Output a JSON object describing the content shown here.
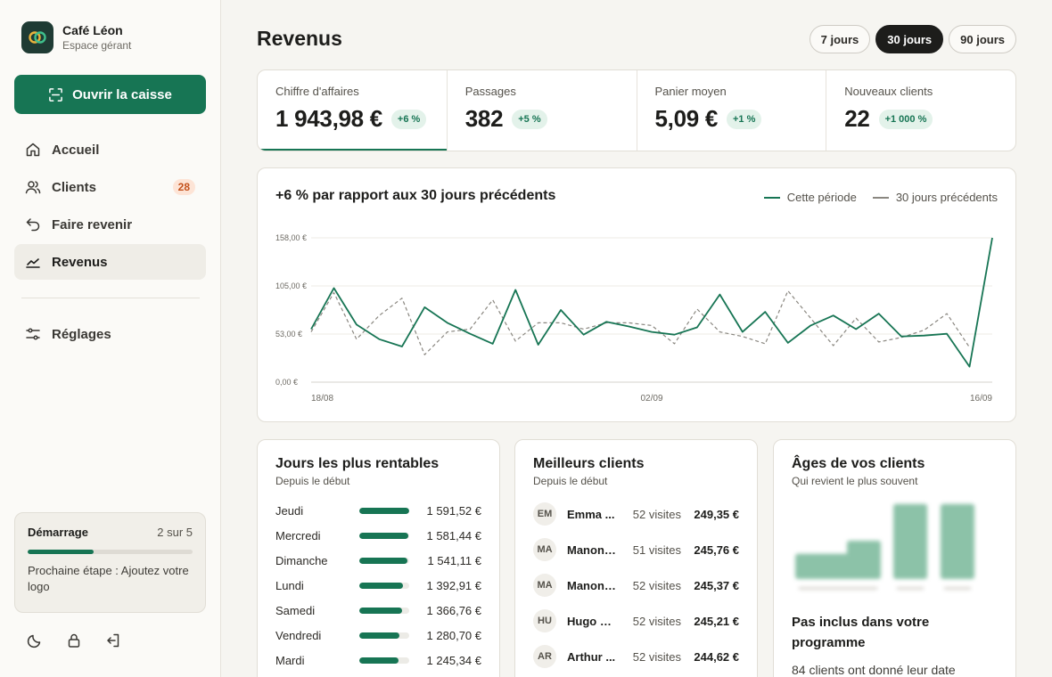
{
  "brand": {
    "name": "Café Léon",
    "subtitle": "Espace gérant"
  },
  "sidebar": {
    "cta_label": "Ouvrir la caisse",
    "items": [
      {
        "label": "Accueil",
        "icon": "home-icon"
      },
      {
        "label": "Clients",
        "icon": "users-icon",
        "badge": "28"
      },
      {
        "label": "Faire revenir",
        "icon": "return-icon"
      },
      {
        "label": "Revenus",
        "icon": "trend-icon",
        "active": true
      }
    ],
    "settings_label": "Réglages"
  },
  "onboarding": {
    "title": "Démarrage",
    "step": "2 sur 5",
    "progress": 0.4,
    "next": "Prochaine étape : Ajoutez votre logo"
  },
  "page": {
    "title": "Revenus"
  },
  "periods": [
    {
      "label": "7 jours",
      "active": false
    },
    {
      "label": "30 jours",
      "active": true
    },
    {
      "label": "90 jours",
      "active": false
    }
  ],
  "kpis": [
    {
      "label": "Chiffre d'affaires",
      "value": "1 943,98 €",
      "delta": "+6 %"
    },
    {
      "label": "Passages",
      "value": "382",
      "delta": "+5 %"
    },
    {
      "label": "Panier moyen",
      "value": "5,09 €",
      "delta": "+1 %"
    },
    {
      "label": "Nouveaux clients",
      "value": "22",
      "delta": "+1 000 %"
    }
  ],
  "chart_data": {
    "type": "line",
    "title": "+6 % par rapport aux 30 jours précédents",
    "legend": [
      "Cette période",
      "30 jours précédents"
    ],
    "y_ticks": [
      "158,00 €",
      "105,00 €",
      "53,00 €",
      "0,00 €"
    ],
    "x_ticks": [
      "18/08",
      "02/09",
      "16/09"
    ],
    "ylim": [
      0,
      158
    ],
    "series": [
      {
        "name": "Cette période",
        "color": "#177554",
        "values": [
          58,
          103,
          63,
          47,
          39,
          82,
          65,
          53,
          42,
          101,
          41,
          79,
          52,
          66,
          61,
          55,
          52,
          60,
          96,
          55,
          77,
          43,
          62,
          73,
          58,
          75,
          50,
          51,
          53,
          17,
          158
        ]
      },
      {
        "name": "30 jours précédents",
        "color": "#8a8780",
        "values": [
          55,
          98,
          47,
          73,
          92,
          30,
          55,
          58,
          90,
          45,
          65,
          65,
          58,
          65,
          65,
          62,
          42,
          80,
          55,
          50,
          42,
          100,
          70,
          40,
          70,
          44,
          49,
          57,
          75,
          38
        ]
      }
    ]
  },
  "top_days": {
    "title": "Jours les plus rentables",
    "subtitle": "Depuis le début",
    "rows": [
      {
        "day": "Jeudi",
        "value": "1 591,52 €",
        "ratio": 1.0
      },
      {
        "day": "Mercredi",
        "value": "1 581,44 €",
        "ratio": 0.99
      },
      {
        "day": "Dimanche",
        "value": "1 541,11 €",
        "ratio": 0.97
      },
      {
        "day": "Lundi",
        "value": "1 392,91 €",
        "ratio": 0.88
      },
      {
        "day": "Samedi",
        "value": "1 366,76 €",
        "ratio": 0.86
      },
      {
        "day": "Vendredi",
        "value": "1 280,70 €",
        "ratio": 0.8
      },
      {
        "day": "Mardi",
        "value": "1 245,34 €",
        "ratio": 0.78
      }
    ]
  },
  "top_clients": {
    "title": "Meilleurs clients",
    "subtitle": "Depuis le début",
    "rows": [
      {
        "initials": "EM",
        "name": "Emma ...",
        "visits": "52 visites",
        "amount": "249,35 €"
      },
      {
        "initials": "MA",
        "name": "Manon ...",
        "visits": "51 visites",
        "amount": "245,76 €"
      },
      {
        "initials": "MA",
        "name": "Manon ...",
        "visits": "52 visites",
        "amount": "245,37 €"
      },
      {
        "initials": "HU",
        "name": "Hugo M...",
        "visits": "52 visites",
        "amount": "245,21 €"
      },
      {
        "initials": "AR",
        "name": "Arthur ...",
        "visits": "52 visites",
        "amount": "244,62 €"
      }
    ]
  },
  "ages": {
    "title": "Âges de vos clients",
    "subtitle": "Qui revient le plus souvent",
    "note_title": "Pas inclus dans votre programme",
    "note_text": "84 clients ont donné leur date",
    "bars": [
      0.33,
      0.5,
      0.98,
      0.98
    ]
  }
}
